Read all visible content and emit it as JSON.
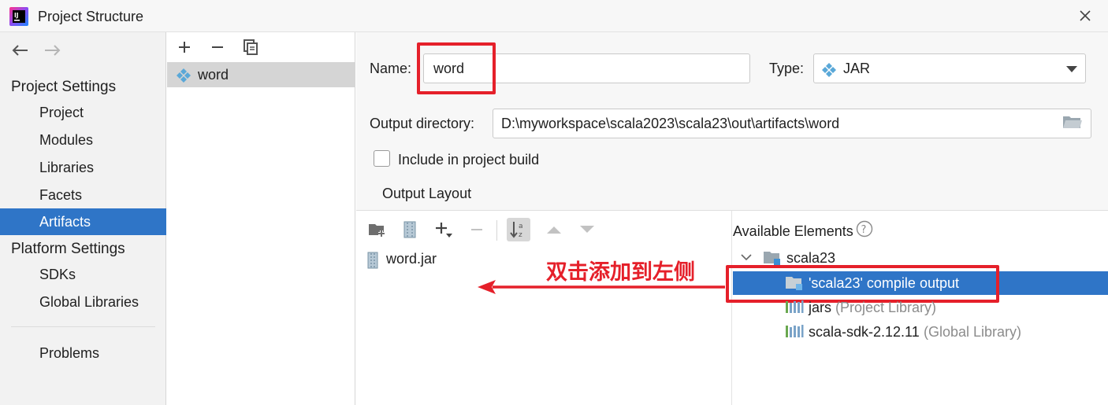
{
  "window": {
    "title": "Project Structure"
  },
  "nav": {
    "back": "back-arrow-icon",
    "forward": "forward-arrow-icon"
  },
  "sidebar": {
    "project_settings": "Project Settings",
    "items": [
      "Project",
      "Modules",
      "Libraries",
      "Facets",
      "Artifacts"
    ],
    "platform_settings": "Platform Settings",
    "platform_items": [
      "SDKs",
      "Global Libraries"
    ],
    "problems": "Problems",
    "selected": "Artifacts"
  },
  "artifacts_list": {
    "items": [
      {
        "label": "word"
      }
    ]
  },
  "form": {
    "name_label": "Name:",
    "name_value": "word",
    "type_label": "Type:",
    "type_value": "JAR",
    "output_dir_label": "Output directory:",
    "output_dir_value": "D:\\myworkspace\\scala2023\\scala23\\out\\artifacts\\word",
    "include_label": "Include in project build",
    "include_checked": false,
    "output_layout_label": "Output Layout"
  },
  "layout": {
    "root_item": "word.jar",
    "available_title": "Available Elements",
    "tree": {
      "module": "scala23",
      "compile_output": "'scala23' compile output",
      "libraries": [
        {
          "name": "jars",
          "detail": "(Project Library)"
        },
        {
          "name": "scala-sdk-2.12.11",
          "detail": "(Global Library)"
        }
      ]
    }
  },
  "annotation": {
    "text": "双击添加到左侧",
    "color": "#e5202a"
  },
  "colors": {
    "selection": "#2f75c7",
    "accent_red": "#e5202a",
    "artifact_diamond": "#4fa3d8"
  }
}
